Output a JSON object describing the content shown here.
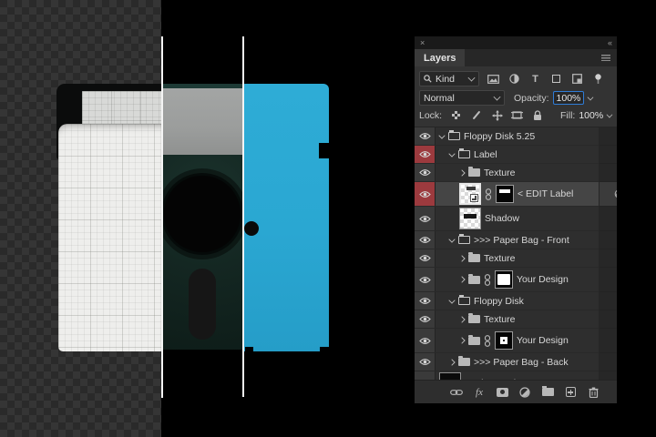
{
  "panel": {
    "title": "Layers",
    "close_glyph": "×",
    "collapse_glyph": "««",
    "filter": {
      "search_label": "Kind",
      "icons": [
        "pixel-layers-filter",
        "adjustment-layers-filter",
        "type-layers-filter",
        "shape-layers-filter",
        "smart-object-filter",
        "filter-toggle"
      ]
    },
    "blend": {
      "mode": "Normal",
      "opacity_label": "Opacity:",
      "opacity_value": "100%"
    },
    "lock": {
      "label": "Lock:",
      "fill_label": "Fill:",
      "fill_value": "100%"
    },
    "layers": [
      {
        "label": "Floppy Disk 5.25",
        "indent": 0,
        "chevron": "open",
        "folder": "open",
        "eye": true
      },
      {
        "label": "Label",
        "indent": 1,
        "chevron": "open",
        "folder": "open",
        "eye": true,
        "color": "red"
      },
      {
        "label": "Texture",
        "indent": 2,
        "chevron": "closed",
        "folder": "closed",
        "eye": true
      },
      {
        "label": "< EDIT Label",
        "indent": 2,
        "eye": true,
        "color": "red",
        "selected": true,
        "tall": true,
        "thumb": "checker-label",
        "link": true,
        "mask": "bar",
        "badges": true
      },
      {
        "label": "Shadow",
        "indent": 2,
        "eye": true,
        "tall": true,
        "thumb": "checker-shadow"
      },
      {
        "label": ">>> Paper Bag - Front",
        "indent": 1,
        "chevron": "open",
        "folder": "open",
        "eye": true
      },
      {
        "label": "Texture",
        "indent": 2,
        "chevron": "closed",
        "folder": "closed",
        "eye": true
      },
      {
        "label": "Your Design",
        "indent": 2,
        "chevron": "closed",
        "folder": "closed",
        "eye": true,
        "tall": true,
        "link": true,
        "mask": "rect"
      },
      {
        "label": "Floppy Disk",
        "indent": 1,
        "chevron": "open",
        "folder": "open",
        "eye": true
      },
      {
        "label": "Texture",
        "indent": 2,
        "chevron": "closed",
        "folder": "closed",
        "eye": true
      },
      {
        "label": "Your Design",
        "indent": 2,
        "chevron": "closed",
        "folder": "closed",
        "eye": true,
        "tall": true,
        "link": true,
        "mask": "dot"
      },
      {
        "label": ">>> Paper Bag - Back",
        "indent": 1,
        "chevron": "closed",
        "folder": "closed",
        "eye": true
      },
      {
        "label": "Background",
        "indent": 0,
        "eye": true,
        "tall": true,
        "thumb": "background"
      }
    ],
    "toolbar": {
      "fx_label": "fx",
      "icons": [
        "link-layers",
        "layer-style",
        "add-layer-mask",
        "new-adjustment-layer",
        "new-group",
        "new-layer",
        "delete-layer"
      ]
    }
  },
  "colors": {
    "panel_bg": "#2e2e2e",
    "controls_bg": "#333333",
    "selected_row": "#454545",
    "red_layer_tag": "#9c3a3e",
    "opacity_focus_border": "#2f7cd6",
    "checker_dark": "#2a2a2a",
    "checker_light": "#353535",
    "divider_line": "#f4f4f4",
    "sleeve_paper": "#eeeeec",
    "opening_label_gray": "#d8d9d7",
    "disk_teal": "#142722",
    "disk_label_gray": "#9b9d9c",
    "disk_blue": "#2aa7d2",
    "canvas_bg": "#000000"
  }
}
